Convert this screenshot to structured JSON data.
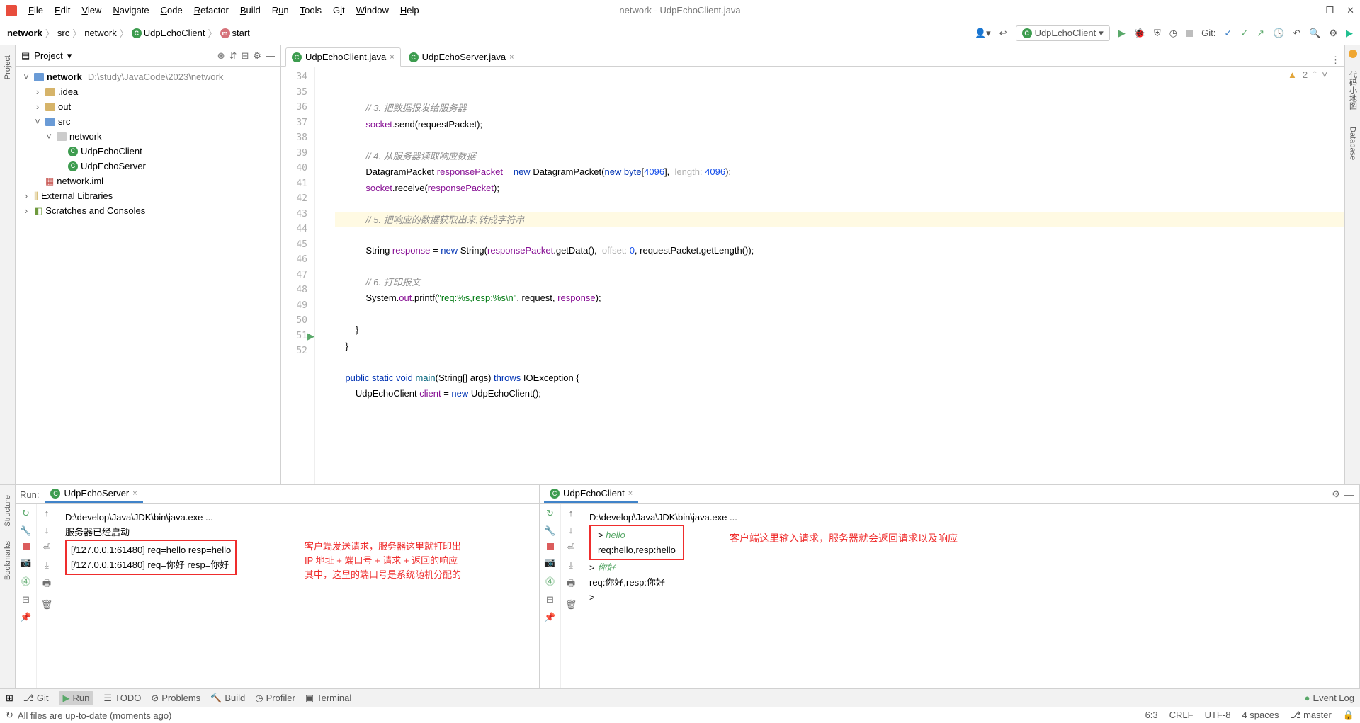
{
  "menubar": {
    "items": [
      "File",
      "Edit",
      "View",
      "Navigate",
      "Code",
      "Refactor",
      "Build",
      "Run",
      "Tools",
      "Git",
      "Window",
      "Help"
    ],
    "title": "network - UdpEchoClient.java"
  },
  "breadcrumb": {
    "items": [
      "network",
      "src",
      "network",
      "UdpEchoClient",
      "start"
    ]
  },
  "toolbar": {
    "run_config": "UdpEchoClient",
    "git_label": "Git:"
  },
  "project_panel": {
    "title": "Project",
    "root": {
      "name": "network",
      "path": "D:\\study\\JavaCode\\2023\\network"
    },
    "nodes": {
      "idea": ".idea",
      "out": "out",
      "src": "src",
      "pkg": "network",
      "client": "UdpEchoClient",
      "server": "UdpEchoServer",
      "iml": "network.iml",
      "ext_lib": "External Libraries",
      "scratches": "Scratches and Consoles"
    }
  },
  "editor": {
    "tabs": [
      {
        "label": "UdpEchoClient.java",
        "active": true
      },
      {
        "label": "UdpEchoServer.java",
        "active": false
      }
    ],
    "warnings": "2",
    "line_start": 34,
    "lines": [
      "",
      "            // 3. 把数据报发给服务器",
      "            socket.send(requestPacket);",
      "",
      "            // 4. 从服务器读取响应数据",
      "            DatagramPacket responsePacket = new DatagramPacket(new byte[4096],  length: 4096);",
      "            socket.receive(responsePacket);",
      "",
      "            // 5. 把响应的数据获取出来,转成字符串",
      "            String response = new String(responsePacket.getData(),  offset: 0, requestPacket.getLength());",
      "",
      "            // 6. 打印报文",
      "            System.out.printf(\"req:%s,resp:%s\\n\", request, response);",
      "",
      "        }",
      "    }",
      "",
      "    public static void main(String[] args) throws IOException {",
      "        UdpEchoClient client = new UdpEchoClient();"
    ]
  },
  "run": {
    "label": "Run:",
    "server_tab": "UdpEchoServer",
    "client_tab": "UdpEchoClient",
    "server_console": {
      "cmd": "D:\\develop\\Java\\JDK\\bin\\java.exe ...",
      "started": "服务器已经启动",
      "line1": "[/127.0.0.1:61480] req=hello resp=hello",
      "line2": "[/127.0.0.1:61480] req=你好 resp=你好",
      "annotation_l1": "客户端发送请求，服务器这里就打印出",
      "annotation_l2": "IP 地址 + 端口号 + 请求 + 返回的响应",
      "annotation_l3": "其中，这里的端口号是系统随机分配的"
    },
    "client_console": {
      "cmd": "D:\\develop\\Java\\JDK\\bin\\java.exe ...",
      "prompt1": "> ",
      "input1": "hello",
      "resp1": "req:hello,resp:hello",
      "prompt2": "> ",
      "input2": "你好",
      "resp2": "req:你好,resp:你好",
      "prompt3": "> ",
      "annotation": "客户端这里输入请求，服务器就会返回请求以及响应"
    }
  },
  "bottom_toolbar": {
    "git": "Git",
    "run": "Run",
    "todo": "TODO",
    "problems": "Problems",
    "build": "Build",
    "profiler": "Profiler",
    "terminal": "Terminal",
    "event_log": "Event Log"
  },
  "statusbar": {
    "message": "All files are up-to-date (moments ago)",
    "pos": "6:3",
    "crlf": "CRLF",
    "enc": "UTF-8",
    "indent": "4 spaces",
    "branch": "master"
  },
  "side_tabs": {
    "project": "Project",
    "structure": "Structure",
    "bookmarks": "Bookmarks",
    "database": "Database",
    "codeglance": "代码小地图"
  }
}
